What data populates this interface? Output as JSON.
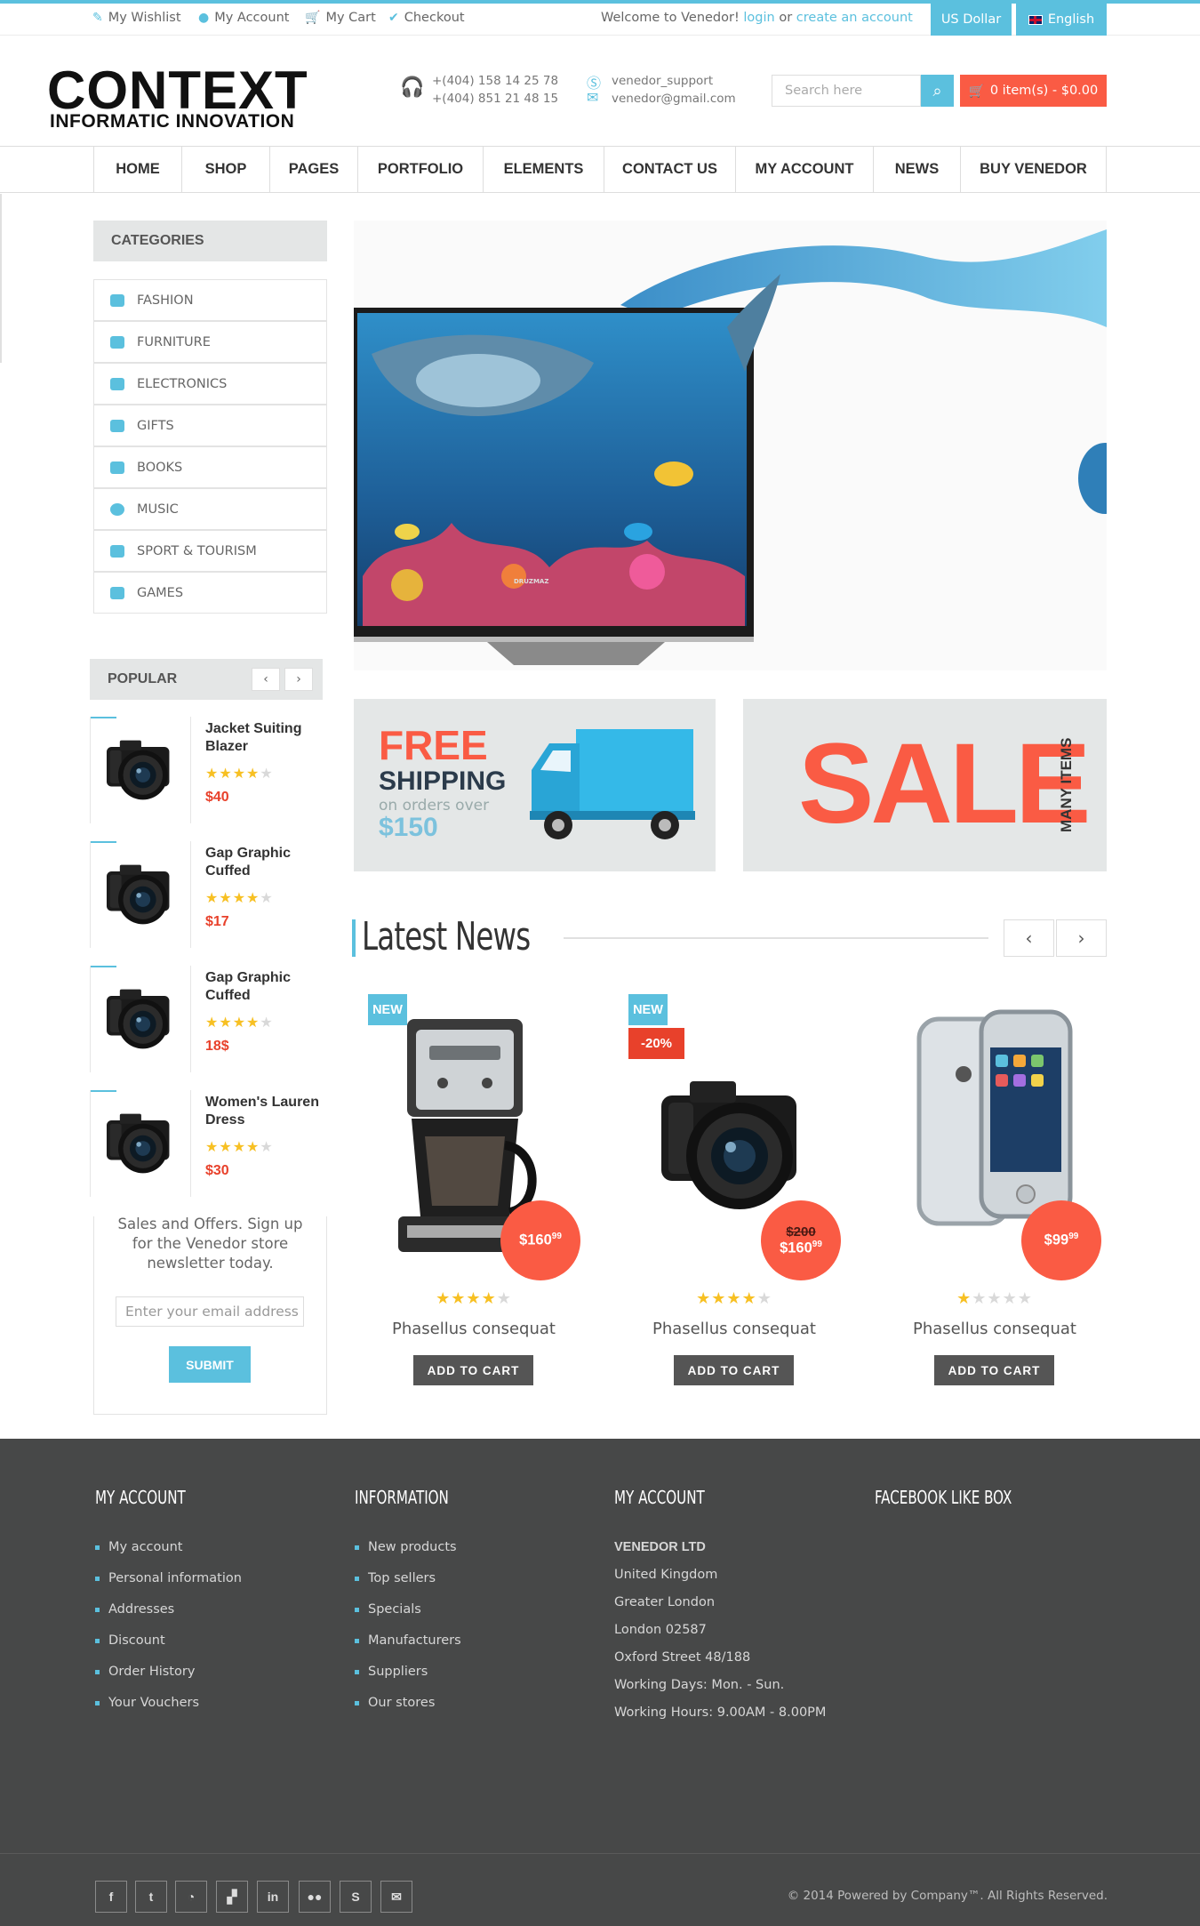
{
  "topbar": {
    "links": [
      "My Wishlist",
      "My Account",
      "My Cart",
      "Checkout"
    ],
    "welcome": "Welcome to Venedor!",
    "login": "login",
    "or": "or",
    "create_account": "create an account",
    "currency": "US Dollar",
    "language": "English"
  },
  "header": {
    "logo_main": "CONTEXT",
    "logo_sub": "INFORMATIC INNOVATION",
    "phone1": "+(404) 158 14 25 78",
    "phone2": "+(404) 851 21 48 15",
    "skype": "venedor_support",
    "email": "venedor@gmail.com",
    "search_placeholder": "Search here",
    "cart_label": "0 item(s) - $0.00"
  },
  "nav": [
    "HOME",
    "SHOP",
    "PAGES",
    "PORTFOLIO",
    "ELEMENTS",
    "CONTACT US",
    "MY ACCOUNT",
    "NEWS",
    "BUY VENEDOR"
  ],
  "categories": {
    "title": "CATEGORIES",
    "items": [
      "FASHION",
      "FURNITURE",
      "ELECTRONICS",
      "GIFTS",
      "BOOKS",
      "MUSIC",
      "SPORT & TOURISM",
      "GAMES"
    ]
  },
  "popular": {
    "title": "POPULAR",
    "items": [
      {
        "name": "Jacket Suiting Blazer",
        "price": "$40",
        "rating": 4
      },
      {
        "name": "Gap Graphic Cuffed",
        "price": "$17",
        "rating": 4
      },
      {
        "name": "Gap Graphic Cuffed",
        "price": "18$",
        "rating": 4
      },
      {
        "name": "Women's Lauren Dress",
        "price": "$30",
        "rating": 4
      }
    ]
  },
  "newsletter": {
    "text": "Sales and Offers. Sign up for the Venedor store newsletter today.",
    "placeholder": "Enter your email address",
    "submit": "SUBMIT"
  },
  "banners": {
    "ship_line1": "FREE",
    "ship_line2": "SHIPPING",
    "ship_line3": "on orders over",
    "ship_line4": "$150",
    "sale_big": "SALE",
    "sale_side": "MANY ITEMS",
    "tv_brand": "DRUZMAZ"
  },
  "latest_news": {
    "title": "Latest News",
    "products": [
      {
        "name": "Phasellus consequat",
        "badge": "NEW",
        "discount": "",
        "price": "$160",
        "cents": "99",
        "old_price": "",
        "rating": 4,
        "button": "ADD TO CART"
      },
      {
        "name": "Phasellus consequat",
        "badge": "NEW",
        "discount": "-20%",
        "price": "$160",
        "cents": "99",
        "old_price": "$200",
        "rating": 4,
        "button": "ADD TO CART"
      },
      {
        "name": "Phasellus consequat",
        "badge": "",
        "discount": "",
        "price": "$99",
        "cents": "99",
        "old_price": "",
        "rating": 1,
        "button": "ADD TO CART"
      }
    ]
  },
  "footer": {
    "col1_title": "MY ACCOUNT",
    "col1_items": [
      "My account",
      "Personal information",
      "Addresses",
      "Discount",
      "Order History",
      "Your Vouchers"
    ],
    "col2_title": "INFORMATION",
    "col2_items": [
      "New products",
      "Top sellers",
      "Specials",
      "Manufacturers",
      "Suppliers",
      "Our stores"
    ],
    "col3_title": "MY ACCOUNT",
    "col3_company": "VENEDOR LTD",
    "col3_lines": [
      "United Kingdom",
      "Greater London",
      "London 02587",
      "Oxford Street 48/188",
      "Working Days: Mon. - Sun.",
      "Working Hours: 9.00AM - 8.00PM"
    ],
    "col4_title": "FACEBOOK LIKE BOX",
    "social": [
      "facebook-icon",
      "twitter-icon",
      "rss-icon",
      "delicious-icon",
      "linkedin-icon",
      "flickr-icon",
      "skype-icon",
      "mail-icon"
    ],
    "copyright": "© 2014 Powered by Company™. All Rights Reserved."
  },
  "colors": {
    "accent": "#5bc0de",
    "sale": "#fa5b44",
    "footer": "#474848",
    "star": "#f7c023"
  }
}
